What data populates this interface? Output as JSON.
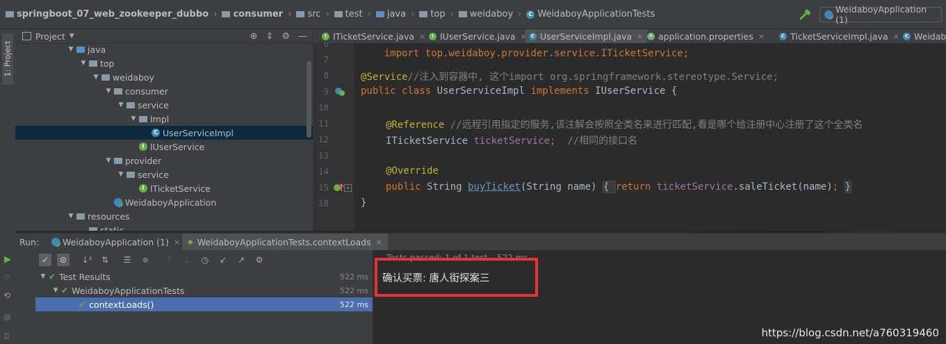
{
  "breadcrumb": {
    "items": [
      "springboot_07_web_zookeeper_dubbo",
      "consumer",
      "src",
      "test",
      "java",
      "top",
      "weidaboy",
      "WeidaboyApplicationTests"
    ]
  },
  "run_config": {
    "label": "WeidaboyApplication (1)"
  },
  "left_strip": {
    "project_tab": "1: Project"
  },
  "project": {
    "title": "Project",
    "tree": [
      {
        "label": "java",
        "icon": "folder-blue",
        "expanded": true
      },
      {
        "label": "top",
        "icon": "folder",
        "expanded": true
      },
      {
        "label": "weidaboy",
        "icon": "folder",
        "expanded": true
      },
      {
        "label": "consumer",
        "icon": "folder",
        "expanded": true
      },
      {
        "label": "service",
        "icon": "folder",
        "expanded": true
      },
      {
        "label": "Impl",
        "icon": "folder",
        "expanded": true
      },
      {
        "label": "UserServiceImpl",
        "icon": "class-icon",
        "selected": true
      },
      {
        "label": "IUserService",
        "icon": "interface-icon"
      },
      {
        "label": "provider",
        "icon": "folder",
        "expanded": true
      },
      {
        "label": "service",
        "icon": "folder",
        "expanded": true
      },
      {
        "label": "ITicketService",
        "icon": "interface-icon"
      },
      {
        "label": "WeidaboyApplication",
        "icon": "spring-app-icon"
      },
      {
        "label": "resources",
        "icon": "folder",
        "expanded": true
      },
      {
        "label": "static",
        "icon": "folder"
      }
    ]
  },
  "editor": {
    "tabs": [
      {
        "label": "ITicketService.java",
        "icon": "interface-icon"
      },
      {
        "label": "IUserService.java",
        "icon": "interface-icon"
      },
      {
        "label": "UserServiceImpl.java",
        "icon": "class-icon",
        "active": true
      },
      {
        "label": "application.properties",
        "icon": "properties-icon"
      },
      {
        "label": "TicketServiceImpl.java",
        "icon": "class-icon"
      },
      {
        "label": "Weidabo",
        "icon": "class-icon"
      }
    ],
    "line_numbers": [
      "6",
      "7",
      "8",
      "9",
      "10",
      "11",
      "12",
      "13",
      "14",
      "15",
      "18"
    ],
    "code": {
      "l6": "import top.weidaboy.provider.service.ITicketService;",
      "l8_ann": "@Service",
      "l8_cmt": "//注入到容器中, 这个import org.springframework.stereotype.Service;",
      "l9_kw1": "public class ",
      "l9_name": "UserServiceImpl ",
      "l9_kw2": "implements ",
      "l9_rest": "IUserService {",
      "l11_ann": "@Reference ",
      "l11_cmt": "//远程引用指定的服务,该注解会按照全类名来进行匹配,看是哪个给注册中心注册了这个全类名",
      "l12_type": "ITicketService ",
      "l12_field": "ticketService",
      "l12_semi": ";  ",
      "l12_cmt": "//相同的接口名",
      "l14_ann": "@Override",
      "l15_kw": "public ",
      "l15_type": "String ",
      "l15_method": "buyTicket",
      "l15_params": "(String name) ",
      "l15_open": "{ ",
      "l15_ret": "return ",
      "l15_field": "ticketService",
      "l15_call": ".saleTicket(name)",
      "l15_semi": "; ",
      "l15_close": "}",
      "l18": "}"
    }
  },
  "run": {
    "label": "Run:",
    "tabs": [
      {
        "label": "WeidaboyApplication (1)"
      },
      {
        "label": "WeidaboyApplicationTests.contextLoads",
        "active": true
      }
    ],
    "results": [
      {
        "label": "Test Results",
        "time": "522 ms"
      },
      {
        "label": "WeidaboyApplicationTests",
        "time": "522 ms"
      },
      {
        "label": "contextLoads()",
        "time": "522 ms",
        "selected": true
      }
    ],
    "status": "Tests passed: 1 of 1 test – 522 ms",
    "output": "确认买票: 唐人街探案三"
  },
  "watermark": "https://blog.csdn.net/a760319460",
  "colors": {
    "highlight_box": "#e53434",
    "selection": "#4b6eaf",
    "pass_green": "#62b543"
  }
}
